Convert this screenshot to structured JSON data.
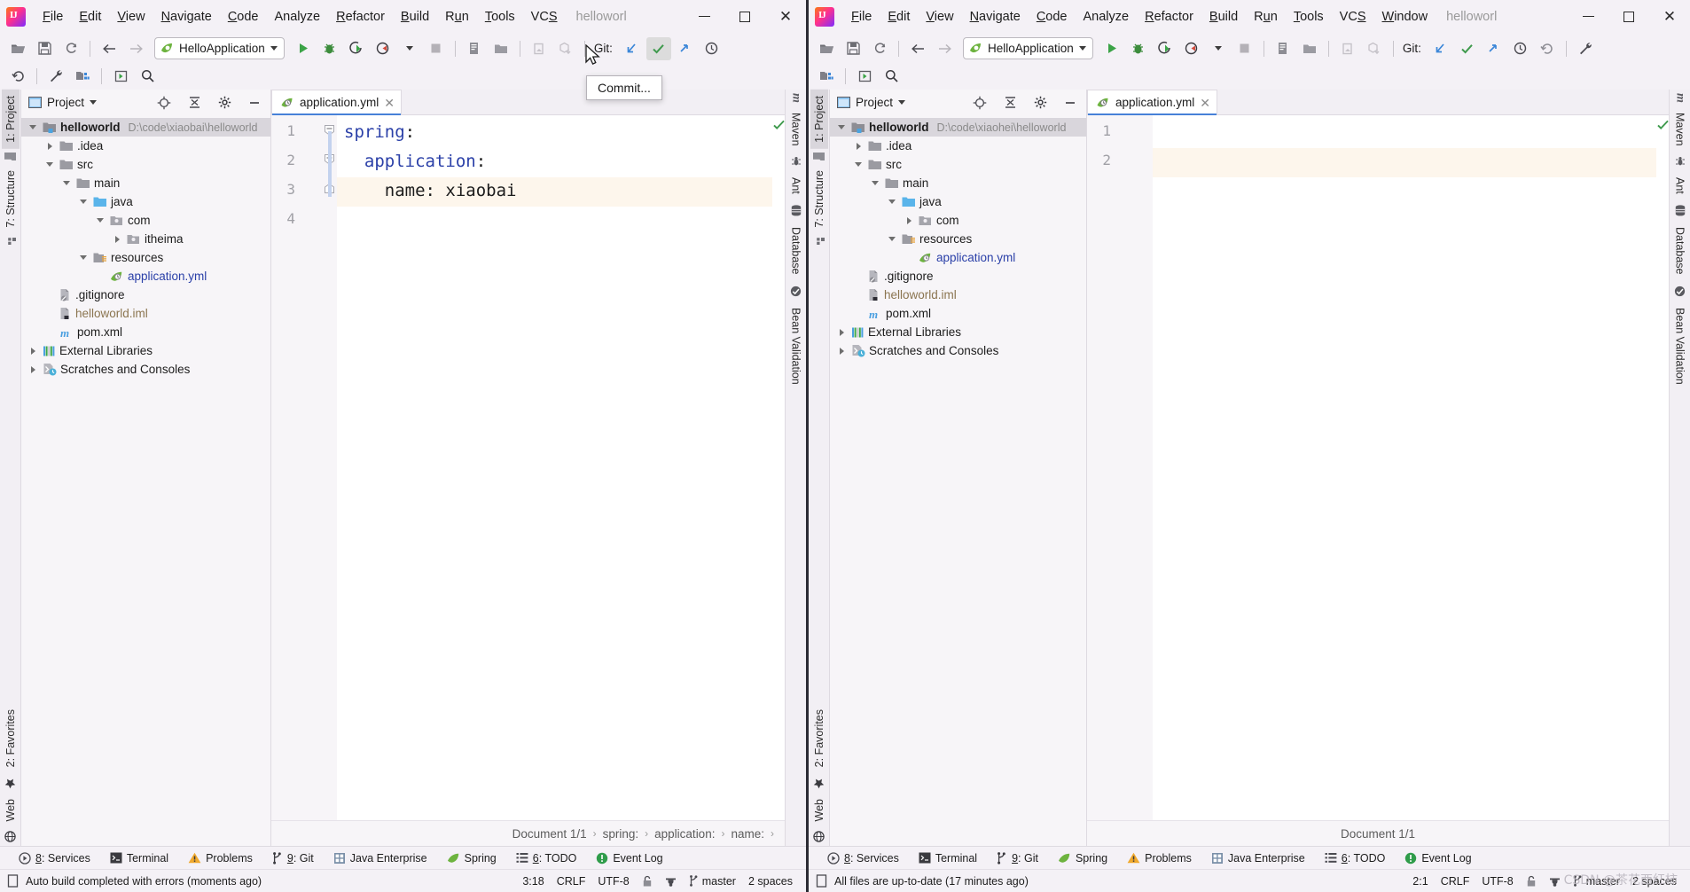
{
  "windows": [
    {
      "id": "left",
      "title": "helloworl",
      "menu": [
        "File",
        "Edit",
        "View",
        "Navigate",
        "Code",
        "Analyze",
        "Refactor",
        "Build",
        "Run",
        "Tools",
        "VCS"
      ],
      "run_config": "HelloApplication",
      "git_label": "Git:",
      "project_panel": {
        "title": "Project",
        "tree": [
          {
            "label": "helloworld",
            "path": "D:\\code\\xiaobai\\helloworld",
            "indent": 0,
            "arrow": "open",
            "icon": "module-icon",
            "bold": true,
            "selected": true
          },
          {
            "label": ".idea",
            "indent": 1,
            "arrow": "closed",
            "icon": "folder-icon"
          },
          {
            "label": "src",
            "indent": 1,
            "arrow": "open",
            "icon": "folder-icon"
          },
          {
            "label": "main",
            "indent": 2,
            "arrow": "open",
            "icon": "folder-icon"
          },
          {
            "label": "java",
            "indent": 3,
            "arrow": "open",
            "icon": "source-folder-icon"
          },
          {
            "label": "com",
            "indent": 4,
            "arrow": "open",
            "icon": "package-icon"
          },
          {
            "label": "itheima",
            "indent": 5,
            "arrow": "closed",
            "icon": "package-icon"
          },
          {
            "label": "resources",
            "indent": 3,
            "arrow": "open",
            "icon": "resources-folder-icon"
          },
          {
            "label": "application.yml",
            "indent": 4,
            "arrow": "none",
            "icon": "spring-yml-icon",
            "color": "blue"
          },
          {
            "label": ".gitignore",
            "indent": 1,
            "arrow": "none",
            "icon": "gitignore-icon"
          },
          {
            "label": "helloworld.iml",
            "indent": 1,
            "arrow": "none",
            "icon": "iml-icon",
            "color": "tan"
          },
          {
            "label": "pom.xml",
            "indent": 1,
            "arrow": "none",
            "icon": "maven-pom-icon"
          },
          {
            "label": "External Libraries",
            "indent": 0,
            "arrow": "closed",
            "icon": "libraries-icon"
          },
          {
            "label": "Scratches and Consoles",
            "indent": 0,
            "arrow": "closed",
            "icon": "scratches-icon"
          }
        ]
      },
      "left_stripe": [
        "1: Project",
        "7: Structure"
      ],
      "left_stripe_bottom": [
        "2: Favorites",
        "Web"
      ],
      "right_stripe": [
        "Maven",
        "Ant",
        "Database",
        "Bean Validation"
      ],
      "editor": {
        "tab": "application.yml",
        "lines": [
          {
            "num": "1",
            "segments": [
              {
                "t": "spring",
                "c": "kw"
              },
              {
                "t": ":",
                "c": "pl"
              }
            ],
            "fold": "open-top"
          },
          {
            "num": "2",
            "segments": [
              {
                "t": "  application",
                "c": "kw"
              },
              {
                "t": ":",
                "c": "pl"
              }
            ],
            "fold": "open-mid"
          },
          {
            "num": "3",
            "segments": [
              {
                "t": "    name",
                "c": "pl"
              },
              {
                "t": ": ",
                "c": "pl"
              },
              {
                "t": "xiaobai",
                "c": "pl"
              }
            ],
            "fold": "end",
            "highlight": true
          },
          {
            "num": "4",
            "segments": [],
            "fold": "none"
          }
        ]
      },
      "breadcrumb": [
        "Document 1/1",
        "spring:",
        "application:",
        "name:"
      ],
      "tool_windows": [
        "8: Services",
        "Terminal",
        "Problems",
        "9: Git",
        "Java Enterprise",
        "Spring",
        "6: TODO",
        "Event Log"
      ],
      "status": {
        "message": "Auto build completed with errors (moments ago)",
        "caret": "3:18",
        "line_sep": "CRLF",
        "encoding": "UTF-8",
        "branch": "master",
        "indent": "2 spaces"
      },
      "tooltip": "Commit..."
    },
    {
      "id": "right",
      "title": "helloworl",
      "menu": [
        "File",
        "Edit",
        "View",
        "Navigate",
        "Code",
        "Analyze",
        "Refactor",
        "Build",
        "Run",
        "Tools",
        "VCS",
        "Window"
      ],
      "run_config": "HelloApplication",
      "git_label": "Git:",
      "project_panel": {
        "title": "Project",
        "tree": [
          {
            "label": "helloworld",
            "path": "D:\\code\\xiaohei\\helloworld",
            "indent": 0,
            "arrow": "open",
            "icon": "module-icon",
            "bold": true,
            "selected": true
          },
          {
            "label": ".idea",
            "indent": 1,
            "arrow": "closed",
            "icon": "folder-icon"
          },
          {
            "label": "src",
            "indent": 1,
            "arrow": "open",
            "icon": "folder-icon"
          },
          {
            "label": "main",
            "indent": 2,
            "arrow": "open",
            "icon": "folder-icon"
          },
          {
            "label": "java",
            "indent": 3,
            "arrow": "open",
            "icon": "source-folder-icon"
          },
          {
            "label": "com",
            "indent": 4,
            "arrow": "closed",
            "icon": "package-icon"
          },
          {
            "label": "resources",
            "indent": 3,
            "arrow": "open",
            "icon": "resources-folder-icon"
          },
          {
            "label": "application.yml",
            "indent": 4,
            "arrow": "none",
            "icon": "spring-yml-icon",
            "color": "blue"
          },
          {
            "label": ".gitignore",
            "indent": 1,
            "arrow": "none",
            "icon": "gitignore-icon"
          },
          {
            "label": "helloworld.iml",
            "indent": 1,
            "arrow": "none",
            "icon": "iml-icon",
            "color": "tan"
          },
          {
            "label": "pom.xml",
            "indent": 1,
            "arrow": "none",
            "icon": "maven-pom-icon"
          },
          {
            "label": "External Libraries",
            "indent": 0,
            "arrow": "closed",
            "icon": "libraries-icon"
          },
          {
            "label": "Scratches and Consoles",
            "indent": 0,
            "arrow": "closed",
            "icon": "scratches-icon"
          }
        ]
      },
      "left_stripe": [
        "1: Project",
        "7: Structure"
      ],
      "left_stripe_bottom": [
        "2: Favorites",
        "Web"
      ],
      "right_stripe": [
        "Maven",
        "Ant",
        "Database",
        "Bean Validation"
      ],
      "editor": {
        "tab": "application.yml",
        "lines": [
          {
            "num": "1",
            "segments": [],
            "fold": "none"
          },
          {
            "num": "2",
            "segments": [],
            "fold": "none",
            "highlight": true
          }
        ]
      },
      "breadcrumb": [
        "Document 1/1"
      ],
      "tool_windows": [
        "8: Services",
        "Terminal",
        "9: Git",
        "Spring",
        "Problems",
        "Java Enterprise",
        "6: TODO",
        "Event Log"
      ],
      "status": {
        "message": "All files are up-to-date (17 minutes ago)",
        "caret": "2:1",
        "line_sep": "CRLF",
        "encoding": "UTF-8",
        "branch": "master",
        "indent": "2 spaces"
      }
    }
  ],
  "watermark": "CSDN @茶花西红柿",
  "colors": {
    "accent_blue": "#4781d8",
    "run_green": "#4caf50",
    "selection_gray": "#d9d6dc",
    "highlight_line": "#fdf6ec",
    "keyword_blue": "#2b40a8"
  }
}
